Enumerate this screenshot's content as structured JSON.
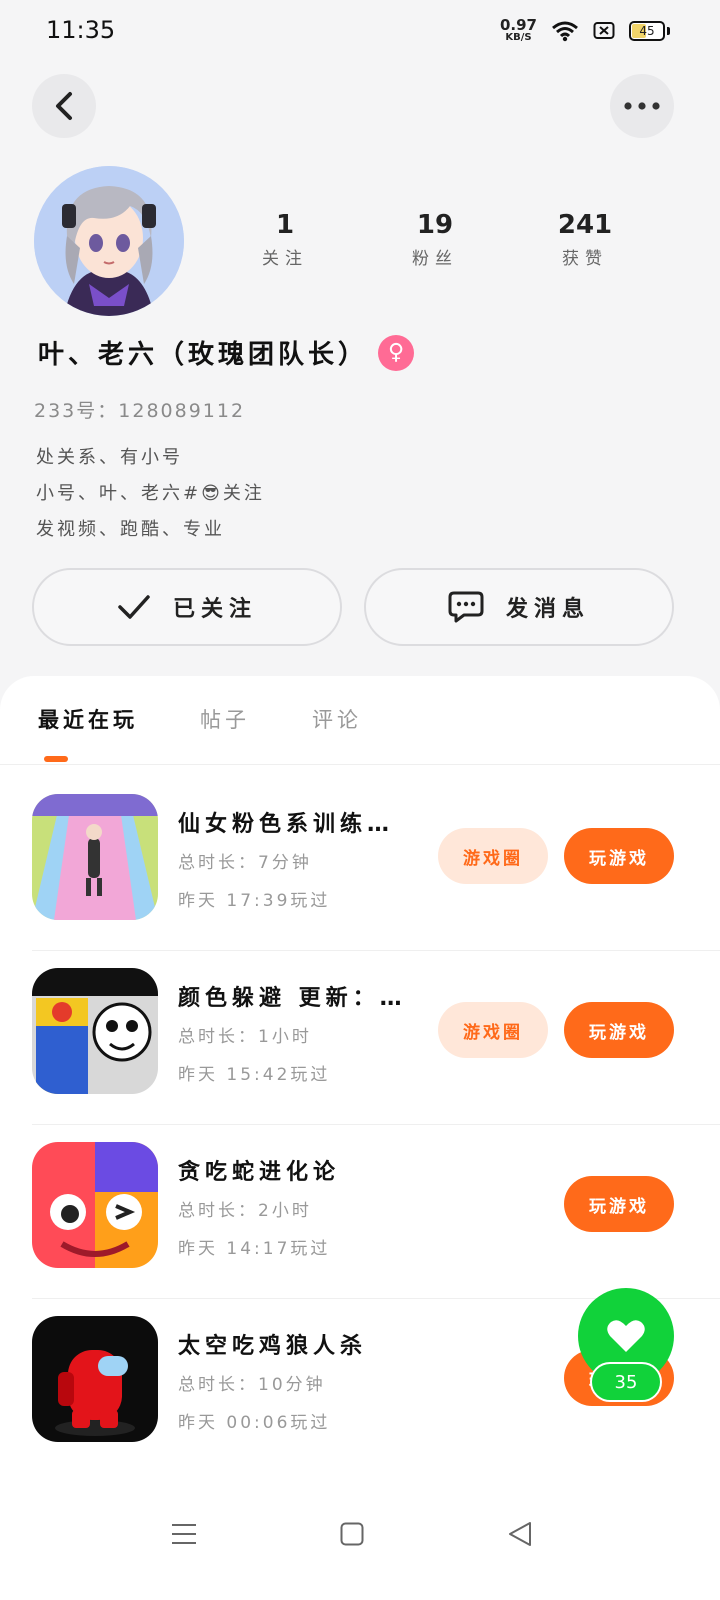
{
  "status_bar": {
    "time": "11:35",
    "net_speed_value": "0.97",
    "net_speed_unit": "KB/S",
    "battery_level": "45",
    "icons": [
      "wifi-icon",
      "sim-disabled-icon",
      "battery-icon"
    ]
  },
  "profile": {
    "stats": [
      {
        "value": "1",
        "label": "关注"
      },
      {
        "value": "19",
        "label": "粉丝"
      },
      {
        "value": "241",
        "label": "获赞"
      }
    ],
    "username": "叶、老六（玫瑰团队长）",
    "user_id": "233号：128089112",
    "bio_lines": [
      "处关系、有小号",
      "小号、叶、老六#😎关注",
      "发视频、跑酷、专业"
    ]
  },
  "actions": {
    "follow_label": "已关注",
    "message_label": "发消息"
  },
  "tabs": [
    {
      "label": "最近在玩",
      "active": true
    },
    {
      "label": "帖子",
      "active": false
    },
    {
      "label": "评论",
      "active": false
    }
  ],
  "games": [
    {
      "title": "仙女粉色系训练…",
      "duration": "总时长：7分钟",
      "last_played": "昨天 17:39玩过",
      "circle_label": "游戏圈",
      "play_label": "玩游戏"
    },
    {
      "title": "颜色躲避 更新：…",
      "duration": "总时长：1小时",
      "last_played": "昨天 15:42玩过",
      "circle_label": "游戏圈",
      "play_label": "玩游戏"
    },
    {
      "title": "贪吃蛇进化论",
      "duration": "总时长：2小时",
      "last_played": "昨天 14:17玩过",
      "play_label": "玩游戏"
    },
    {
      "title": "太空吃鸡狼人杀",
      "duration": "总时长：10分钟",
      "last_played": "昨天 00:06玩过",
      "play_label": "玩游戏"
    }
  ],
  "like_fab": {
    "count": "35"
  },
  "colors": {
    "accent": "#ff6a1a",
    "accent_soft": "#ffe7d9",
    "like_green": "#11d23a",
    "gender_pink": "#ff6b95"
  }
}
